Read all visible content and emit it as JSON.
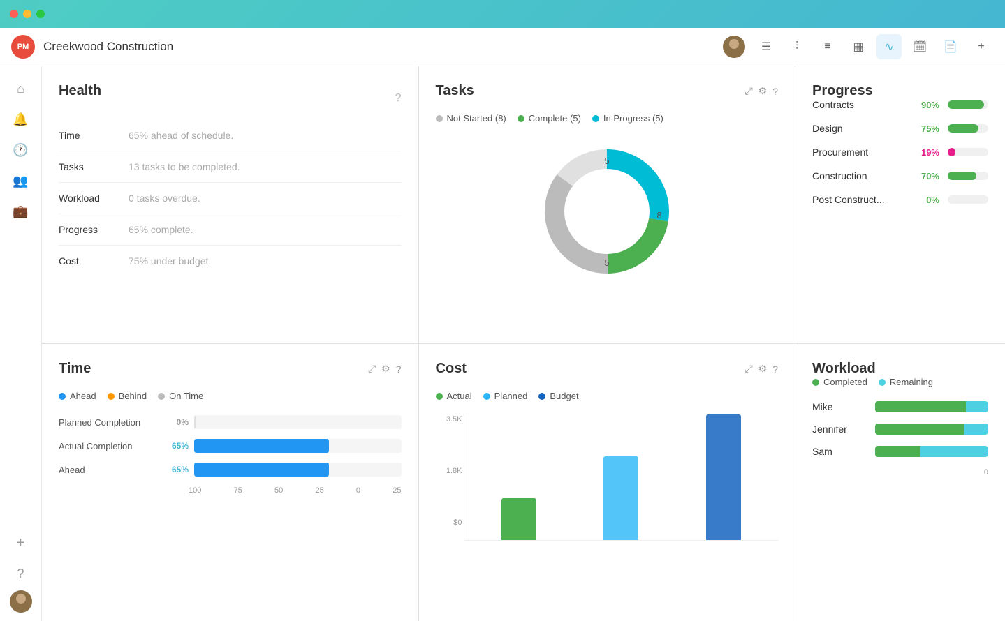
{
  "titlebar": {
    "dots": [
      "red",
      "yellow",
      "green"
    ]
  },
  "header": {
    "logo": "PM",
    "title": "Creekwood Construction",
    "nav_icons": [
      "list",
      "bar-chart",
      "menu",
      "table",
      "activity",
      "calendar",
      "file",
      "plus"
    ],
    "active_nav": 4
  },
  "sidebar": {
    "icons": [
      "home",
      "bell",
      "clock",
      "users",
      "briefcase"
    ],
    "bottom_icons": [
      "plus",
      "help"
    ]
  },
  "health": {
    "title": "Health",
    "rows": [
      {
        "label": "Time",
        "value": "65% ahead of schedule."
      },
      {
        "label": "Tasks",
        "value": "13 tasks to be completed."
      },
      {
        "label": "Workload",
        "value": "0 tasks overdue."
      },
      {
        "label": "Progress",
        "value": "65% complete."
      },
      {
        "label": "Cost",
        "value": "75% under budget."
      }
    ]
  },
  "tasks": {
    "title": "Tasks",
    "legend": [
      {
        "label": "Not Started (8)",
        "color": "#bbb"
      },
      {
        "label": "Complete (5)",
        "color": "#4caf50"
      },
      {
        "label": "In Progress (5)",
        "color": "#00bcd4"
      }
    ],
    "donut": {
      "not_started": 8,
      "complete": 5,
      "in_progress": 5,
      "labels": {
        "top": "5",
        "right": "8",
        "bottom": "5"
      }
    }
  },
  "progress": {
    "title": "Progress",
    "rows": [
      {
        "label": "Contracts",
        "pct": "90%",
        "value": 90,
        "color": "#4caf50"
      },
      {
        "label": "Design",
        "pct": "75%",
        "value": 75,
        "color": "#4caf50"
      },
      {
        "label": "Procurement",
        "pct": "19%",
        "value": 19,
        "color": "#e91e8c"
      },
      {
        "label": "Construction",
        "pct": "70%",
        "value": 70,
        "color": "#4caf50"
      },
      {
        "label": "Post Construct...",
        "pct": "0%",
        "value": 0,
        "color": "#4caf50"
      }
    ]
  },
  "time": {
    "title": "Time",
    "legend": [
      {
        "label": "Ahead",
        "color": "#2196f3"
      },
      {
        "label": "Behind",
        "color": "#ff9800"
      },
      {
        "label": "On Time",
        "color": "#bbb"
      }
    ],
    "bars": [
      {
        "label": "Planned Completion",
        "pct": "0%",
        "value": 0
      },
      {
        "label": "Actual Completion",
        "pct": "65%",
        "value": 65
      },
      {
        "label": "Ahead",
        "pct": "65%",
        "value": 65
      }
    ],
    "axis": [
      "100",
      "75",
      "50",
      "25",
      "0",
      "25"
    ]
  },
  "cost": {
    "title": "Cost",
    "legend": [
      {
        "label": "Actual",
        "color": "#4caf50"
      },
      {
        "label": "Planned",
        "color": "#29b6f6"
      },
      {
        "label": "Budget",
        "color": "#1565c0"
      }
    ],
    "y_labels": [
      "3.5K",
      "1.8K",
      "$0"
    ],
    "bars": [
      {
        "actual": 35,
        "planned": 0,
        "budget": 0
      },
      {
        "actual": 0,
        "planned": 65,
        "budget": 0
      },
      {
        "actual": 0,
        "planned": 0,
        "budget": 100
      }
    ]
  },
  "workload": {
    "title": "Workload",
    "legend": [
      {
        "label": "Completed",
        "color": "#4caf50"
      },
      {
        "label": "Remaining",
        "color": "#4dd0e1"
      }
    ],
    "people": [
      {
        "name": "Mike",
        "completed": 80,
        "remaining": 20
      },
      {
        "name": "Jennifer",
        "completed": 75,
        "remaining": 20
      },
      {
        "name": "Sam",
        "completed": 20,
        "remaining": 30
      }
    ],
    "axis_label": "0"
  }
}
